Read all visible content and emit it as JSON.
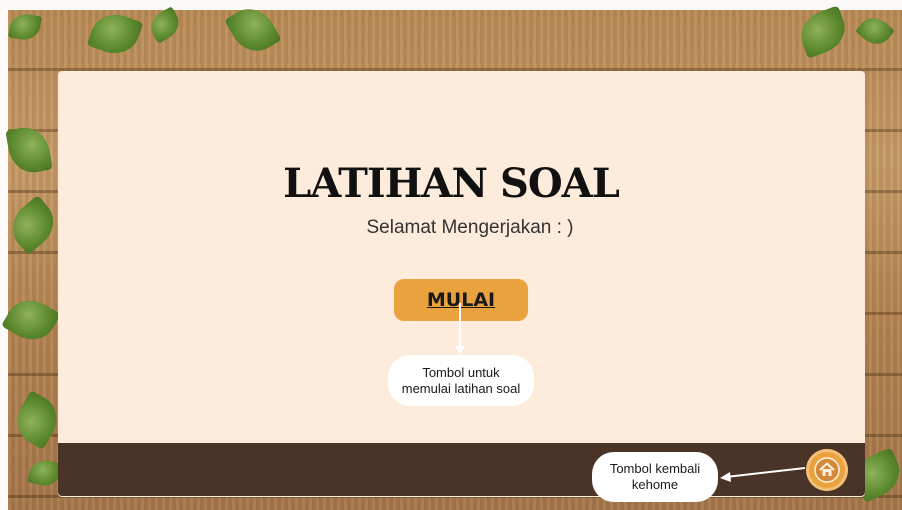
{
  "page": {
    "title": "LATIHAN SOAL",
    "subtitle": "Selamat Mengerjakan : )"
  },
  "buttons": {
    "start_label": "MULAI",
    "home_icon": "home-icon"
  },
  "annotations": {
    "start_line1": "Tombol untuk",
    "start_line2": "memulai latihan soal",
    "home_line1": "Tombol kembali",
    "home_line2": "kehome"
  },
  "colors": {
    "card": "#fdebdc",
    "footer": "#4a3428",
    "accent": "#e9a23e"
  }
}
